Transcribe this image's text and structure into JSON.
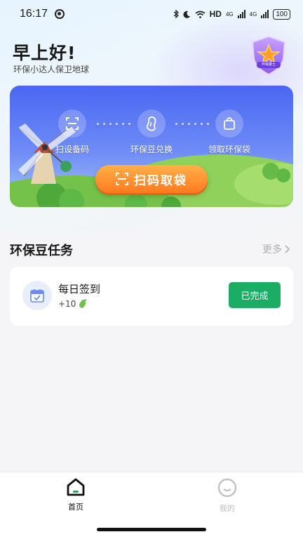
{
  "status_bar": {
    "time": "16:17",
    "network": "HD",
    "sim1": "4G",
    "sim2": "4G",
    "battery": "100"
  },
  "header": {
    "greeting": "早上好!",
    "subtitle": "环保小达人保卫地球",
    "badge_text": "环保勇士"
  },
  "banner": {
    "features": [
      {
        "label": "扫设备码",
        "icon": "scan-icon"
      },
      {
        "label": "环保豆兑换",
        "icon": "bean-icon"
      },
      {
        "label": "领取环保袋",
        "icon": "bag-icon"
      }
    ],
    "scan_button_label": "扫码取袋"
  },
  "tasks": {
    "section_title": "环保豆任务",
    "more_label": "更多",
    "items": [
      {
        "name": "每日签到",
        "reward": "+10",
        "status_label": "已完成",
        "icon": "calendar-check-icon"
      }
    ]
  },
  "tabbar": {
    "tabs": [
      {
        "label": "首页",
        "active": true,
        "icon": "home-icon"
      },
      {
        "label": "我的",
        "active": false,
        "icon": "profile-icon"
      }
    ]
  },
  "colors": {
    "accent_green": "#1aad63",
    "banner_blue": "#4a67f2",
    "scan_orange": "#ff7a1f"
  }
}
